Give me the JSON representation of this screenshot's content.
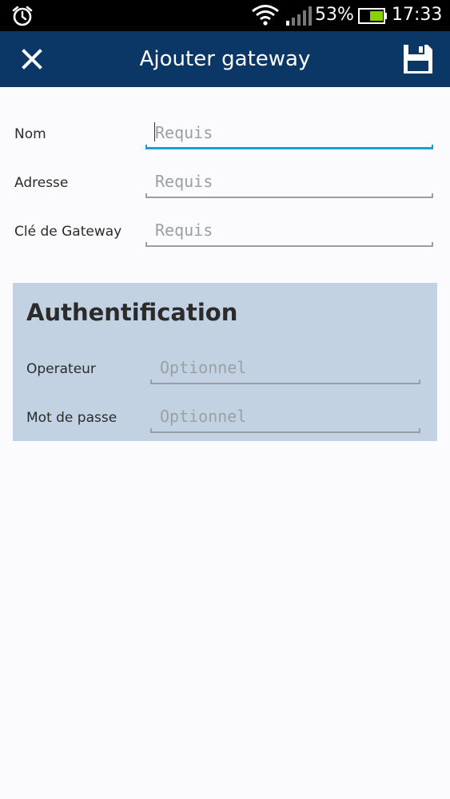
{
  "status_bar": {
    "battery_percent": "53%",
    "time": "17:33",
    "icons": [
      "alarm-icon",
      "wifi-icon",
      "signal-icon",
      "battery-icon"
    ]
  },
  "action_bar": {
    "title": "Ajouter gateway",
    "close_icon": "close-icon",
    "save_icon": "save-icon"
  },
  "form": {
    "fields": [
      {
        "label": "Nom",
        "placeholder": "Requis",
        "value": ""
      },
      {
        "label": "Adresse",
        "placeholder": "Requis",
        "value": ""
      },
      {
        "label": "Clé de Gateway",
        "placeholder": "Requis",
        "value": ""
      }
    ]
  },
  "auth": {
    "heading": "Authentification",
    "fields": [
      {
        "label": "Operateur",
        "placeholder": "Optionnel",
        "value": ""
      },
      {
        "label": "Mot de passe",
        "placeholder": "Optionnel",
        "value": ""
      }
    ]
  },
  "colors": {
    "action_bar": "#0b3766",
    "accent": "#1aa0d8",
    "auth_panel": "#c2d2e2"
  }
}
